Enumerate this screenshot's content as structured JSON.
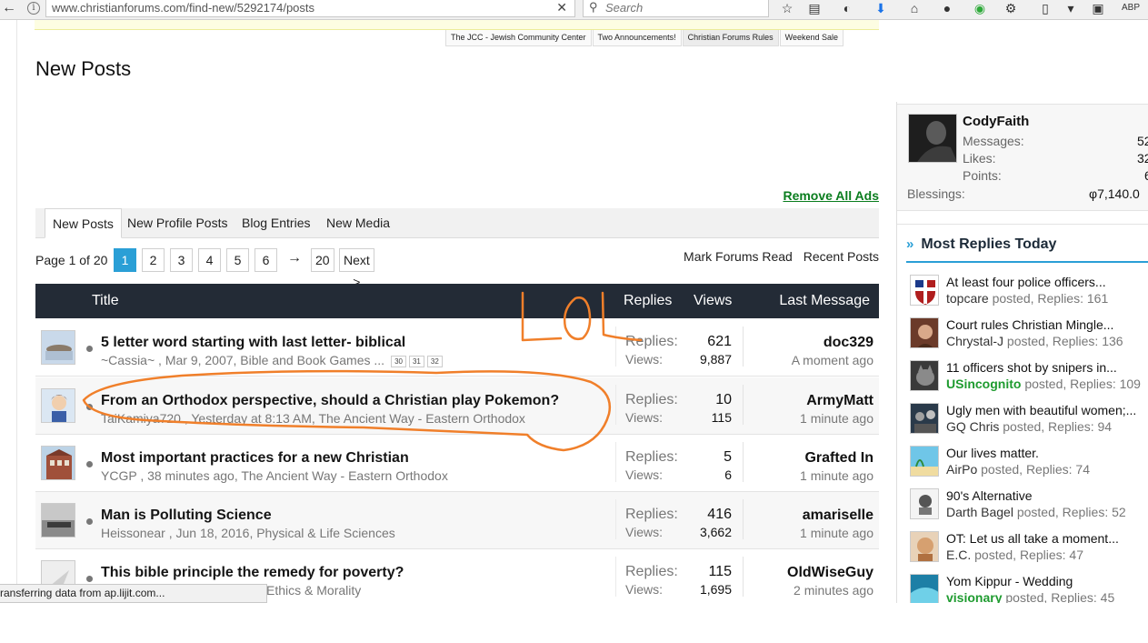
{
  "browser": {
    "url": "www.christianforums.com/find-new/5292174/posts",
    "search_placeholder": "Search",
    "status": "ransferring data from ap.lijit.com..."
  },
  "notices": [
    "The JCC - Jewish Community Center",
    "Two Announcements!",
    "Christian Forums Rules",
    "Weekend Sale"
  ],
  "page_title": "New Posts",
  "remove_ads": "Remove All Ads",
  "tabs": [
    "New Posts",
    "New Profile Posts",
    "Blog Entries",
    "New Media"
  ],
  "pagination": {
    "label": "Page 1 of 20",
    "pages": [
      "1",
      "2",
      "3",
      "4",
      "5",
      "6"
    ],
    "arrow": "→",
    "last": "20",
    "next": "Next >"
  },
  "forum_links": [
    "Mark Forums Read",
    "Recent Posts"
  ],
  "table_header": {
    "title": "Title",
    "replies": "Replies",
    "views": "Views",
    "last": "Last Message"
  },
  "stat_labels": {
    "replies": "Replies:",
    "views": "Views:"
  },
  "threads": [
    {
      "title": "5 letter word starting with last letter- biblical",
      "meta": "~Cassia~ , Mar 9, 2007, Bible and Book Games",
      "pages": [
        "30",
        "31",
        "32"
      ],
      "replies": "621",
      "views": "9,887",
      "last_user": "doc329",
      "last_time": "A moment ago"
    },
    {
      "title": "From an Orthodox perspective, should a Christian play Pokemon?",
      "meta": "TaiKamiya720 , Yesterday at 8:13 AM, The Ancient Way - Eastern Orthodox",
      "pages": [],
      "replies": "10",
      "views": "115",
      "last_user": "ArmyMatt",
      "last_time": "1 minute ago"
    },
    {
      "title": "Most important practices for a new Christian",
      "meta": "YCGP , 38 minutes ago, The Ancient Way - Eastern Orthodox",
      "pages": [],
      "replies": "5",
      "views": "6",
      "last_user": "Grafted In",
      "last_time": "1 minute ago"
    },
    {
      "title": "Man is Polluting Science",
      "meta": "Heissonear , Jun 18, 2016, Physical & Life Sciences",
      "pages": [],
      "replies": "416",
      "views": "3,662",
      "last_user": "amariselle",
      "last_time": "1 minute ago"
    },
    {
      "title": "This bible principle the remedy for poverty?",
      "meta": "Ethics & Morality",
      "pages": [],
      "replies": "115",
      "views": "1,695",
      "last_user": "OldWiseGuy",
      "last_time": "2 minutes ago"
    }
  ],
  "user": {
    "name": "CodyFaith",
    "messages_label": "Messages:",
    "messages": "52",
    "likes_label": "Likes:",
    "likes": "32",
    "points_label": "Points:",
    "points": "6",
    "blessings_label": "Blessings:",
    "blessings": "φ7,140.0"
  },
  "most_replies": {
    "title": "Most Replies Today",
    "items": [
      {
        "title": "At least four police officers...",
        "user": "topcare",
        "green": false,
        "suffix": " posted, Replies: 161"
      },
      {
        "title": "Court rules Christian Mingle...",
        "user": "Chrystal-J",
        "green": false,
        "suffix": " posted, Replies: 136"
      },
      {
        "title": "11 officers shot by snipers in...",
        "user": "USincognito",
        "green": true,
        "suffix": " posted, Replies: 109"
      },
      {
        "title": "Ugly men with beautiful women;...",
        "user": "GQ Chris",
        "green": false,
        "suffix": " posted, Replies: 94"
      },
      {
        "title": "Our lives matter.",
        "user": "AirPo",
        "green": false,
        "suffix": " posted, Replies: 74"
      },
      {
        "title": "90's Alternative",
        "user": "Darth Bagel",
        "green": false,
        "suffix": " posted, Replies: 52"
      },
      {
        "title": "OT: Let us all take a moment...",
        "user": "E.C.",
        "green": false,
        "suffix": " posted, Replies: 47"
      },
      {
        "title": "Yom Kippur - Wedding",
        "user": "visionary",
        "green": true,
        "suffix": " posted, Replies: 45"
      }
    ]
  },
  "colors": {
    "accent": "#2a9fd6",
    "header": "#232b36",
    "green": "#1e9b2f",
    "annotation": "#f07f2a"
  }
}
